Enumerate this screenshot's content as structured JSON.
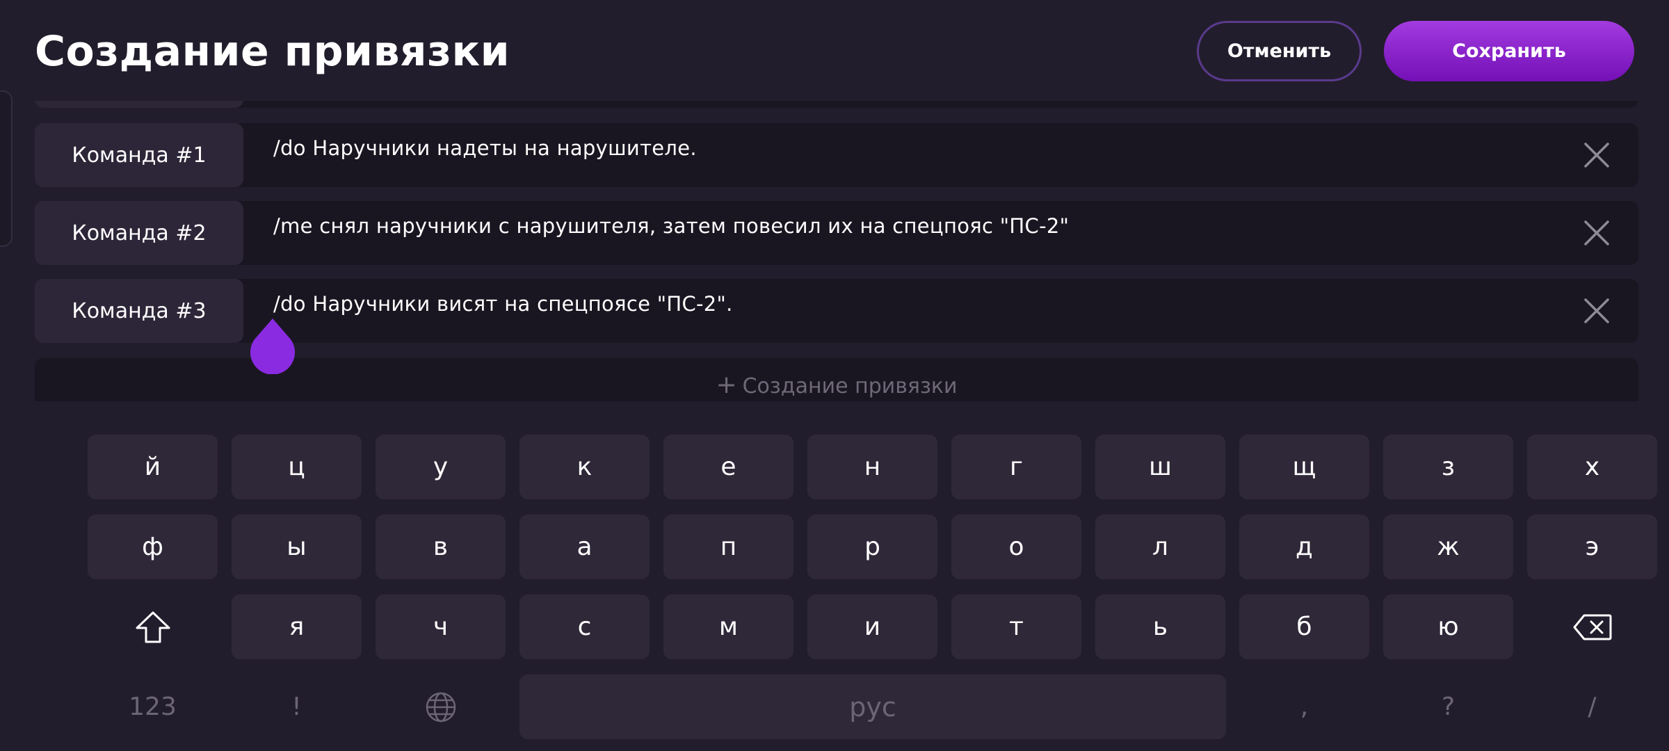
{
  "header": {
    "title": "Создание привязки",
    "cancel_label": "Отменить",
    "save_label": "Сохранить"
  },
  "commands": [
    {
      "label": "Команда #1",
      "text": "/do Наручники надеты на нарушителе."
    },
    {
      "label": "Команда #2",
      "text": "/me снял наручники с нарушителя, затем повесил их на спецпояс \"ПС-2\""
    },
    {
      "label": "Команда #3",
      "text": "/do Наручники висят на спецпоясе \"ПС-2\"."
    }
  ],
  "add_button": {
    "icon": "+",
    "label": "Создание привязки"
  },
  "keyboard": {
    "row1": [
      "й",
      "ц",
      "у",
      "к",
      "е",
      "н",
      "г",
      "ш",
      "щ",
      "з",
      "х"
    ],
    "row2": [
      "ф",
      "ы",
      "в",
      "а",
      "п",
      "р",
      "о",
      "л",
      "д",
      "ж",
      "э"
    ],
    "row3": [
      "я",
      "ч",
      "с",
      "м",
      "и",
      "т",
      "ь",
      "б",
      "ю"
    ],
    "row4": {
      "numbers": "123",
      "exclaim": "!",
      "space": "рус",
      "comma": ",",
      "question": "?",
      "slash": "/"
    },
    "shift_icon": "shift-icon",
    "backspace_icon": "backspace-icon",
    "globe_icon": "globe-icon"
  },
  "colors": {
    "background": "#221d2c",
    "accent": "#8a2be2",
    "save_gradient_top": "#a23be0",
    "save_gradient_bottom": "#7410b6"
  }
}
